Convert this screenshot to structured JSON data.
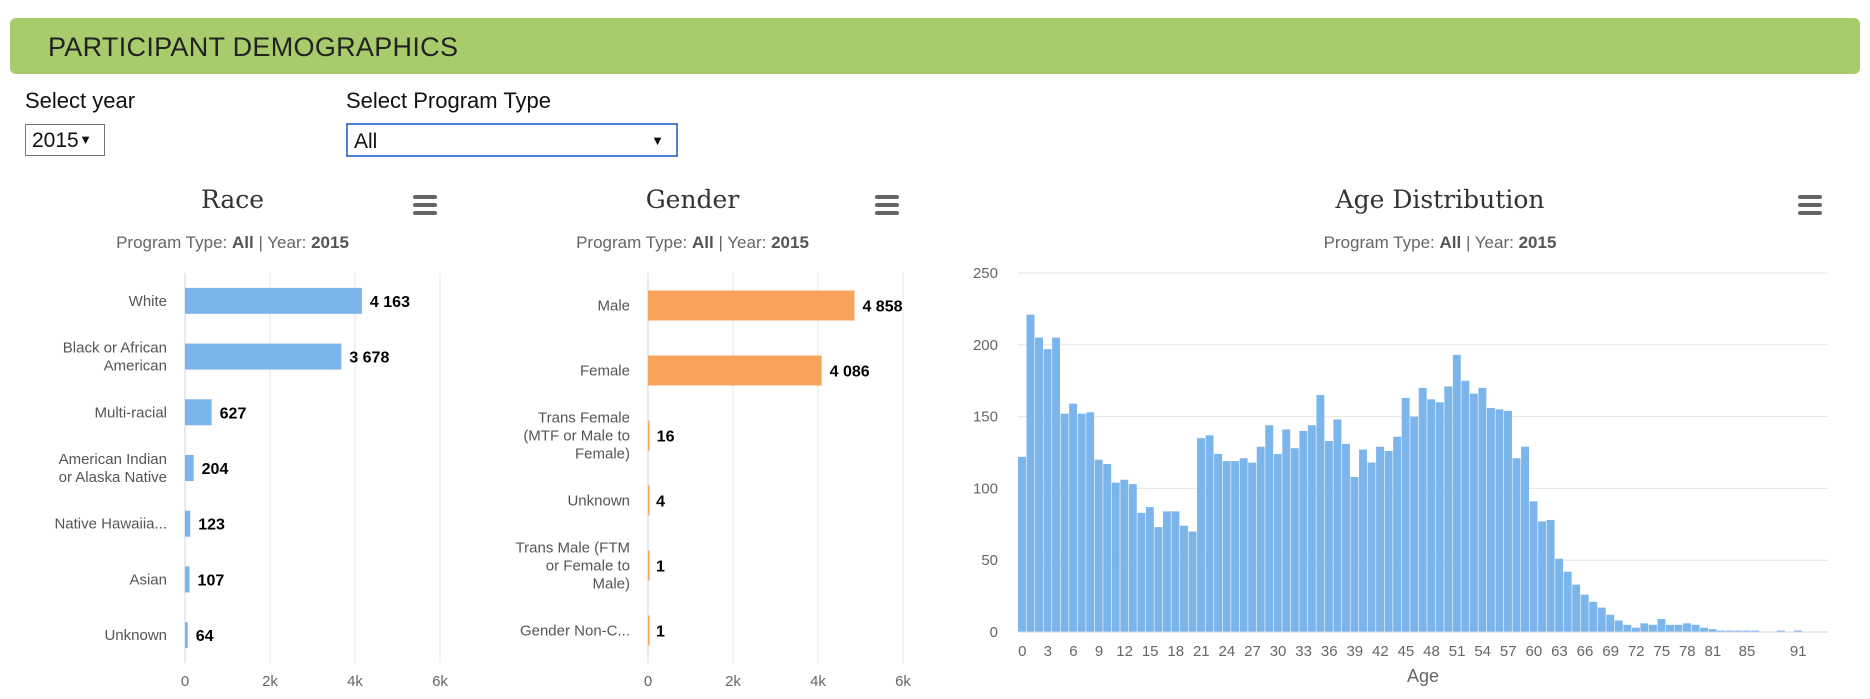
{
  "header": {
    "title": "PARTICIPANT DEMOGRAPHICS"
  },
  "controls": {
    "year_label": "Select year",
    "year_value": "2015",
    "program_label": "Select Program Type",
    "program_value": "All"
  },
  "colors": {
    "banner": "#a8cb6c",
    "blue": "#7cb5ec",
    "orange": "#f7a35c"
  },
  "subtitle": {
    "prefix": "Program Type: ",
    "program": "All",
    "sep": " | Year: ",
    "year": "2015"
  },
  "menu_icon": "hamburger-menu-icon",
  "chart_data": [
    {
      "type": "bar",
      "orientation": "horizontal",
      "title": "Race",
      "categories": [
        [
          "White"
        ],
        [
          "Black or African",
          "American"
        ],
        [
          "Multi-racial"
        ],
        [
          "American Indian",
          "or Alaska Native"
        ],
        [
          "Native Hawaiia..."
        ],
        [
          "Asian"
        ],
        [
          "Unknown"
        ]
      ],
      "values": [
        4163,
        3678,
        627,
        204,
        123,
        107,
        64
      ],
      "data_labels": [
        "4 163",
        "3 678",
        "627",
        "204",
        "123",
        "107",
        "64"
      ],
      "xlim": [
        0,
        6000
      ],
      "ticks": [
        0,
        2000,
        4000,
        6000
      ],
      "tick_labels": [
        "0",
        "2k",
        "4k",
        "6k"
      ],
      "color": "#7cb5ec"
    },
    {
      "type": "bar",
      "orientation": "horizontal",
      "title": "Gender",
      "categories": [
        [
          "Male"
        ],
        [
          "Female"
        ],
        [
          "Trans Female",
          "(MTF or Male to",
          "Female)"
        ],
        [
          "Unknown"
        ],
        [
          "Trans Male (FTM",
          "or Female to",
          "Male)"
        ],
        [
          "Gender Non-C..."
        ]
      ],
      "values": [
        4858,
        4086,
        16,
        4,
        1,
        1
      ],
      "data_labels": [
        "4 858",
        "4 086",
        "16",
        "4",
        "1",
        "1"
      ],
      "xlim": [
        0,
        6000
      ],
      "ticks": [
        0,
        2000,
        4000,
        6000
      ],
      "tick_labels": [
        "0",
        "2k",
        "4k",
        "6k"
      ],
      "color": "#f7a35c"
    },
    {
      "type": "bar",
      "title": "Age Distribution",
      "xlabel": "Age",
      "x": [
        0,
        1,
        2,
        3,
        4,
        5,
        6,
        7,
        8,
        9,
        10,
        11,
        12,
        13,
        14,
        15,
        16,
        17,
        18,
        19,
        20,
        21,
        22,
        23,
        24,
        25,
        26,
        27,
        28,
        29,
        30,
        31,
        32,
        33,
        34,
        35,
        36,
        37,
        38,
        39,
        40,
        41,
        42,
        43,
        44,
        45,
        46,
        47,
        48,
        49,
        50,
        51,
        52,
        53,
        54,
        55,
        56,
        57,
        58,
        59,
        60,
        61,
        62,
        63,
        64,
        65,
        66,
        67,
        68,
        69,
        70,
        71,
        72,
        73,
        74,
        75,
        76,
        77,
        78,
        79,
        80,
        81,
        82,
        83,
        84,
        85,
        86,
        87,
        88,
        89,
        90,
        91,
        92,
        93,
        94
      ],
      "values": [
        122,
        221,
        205,
        197,
        205,
        152,
        159,
        152,
        153,
        120,
        117,
        104,
        106,
        103,
        83,
        87,
        73,
        84,
        84,
        74,
        70,
        135,
        137,
        124,
        119,
        119,
        121,
        118,
        129,
        144,
        124,
        141,
        128,
        140,
        144,
        165,
        133,
        148,
        131,
        108,
        127,
        118,
        129,
        126,
        136,
        163,
        150,
        170,
        162,
        160,
        171,
        193,
        175,
        166,
        170,
        156,
        155,
        154,
        121,
        129,
        91,
        77,
        78,
        51,
        42,
        33,
        26,
        21,
        17,
        12,
        8,
        5,
        3,
        6,
        5,
        9,
        5,
        5,
        6,
        5,
        3,
        2,
        1,
        1,
        1,
        1,
        1,
        0,
        0,
        1,
        0,
        1,
        0,
        0,
        0
      ],
      "xtick_labels": [
        "0",
        "3",
        "6",
        "9",
        "12",
        "15",
        "18",
        "21",
        "24",
        "27",
        "30",
        "33",
        "36",
        "39",
        "42",
        "45",
        "48",
        "51",
        "54",
        "57",
        "60",
        "63",
        "66",
        "69",
        "72",
        "75",
        "78",
        "81",
        "85",
        "91"
      ],
      "xtick_values": [
        0,
        3,
        6,
        9,
        12,
        15,
        18,
        21,
        24,
        27,
        30,
        33,
        36,
        39,
        42,
        45,
        48,
        51,
        54,
        57,
        60,
        63,
        66,
        69,
        72,
        75,
        78,
        81,
        85,
        91
      ],
      "ylim": [
        0,
        250
      ],
      "yticks": [
        0,
        50,
        100,
        150,
        200,
        250
      ],
      "grid": true,
      "color": "#7cb5ec"
    }
  ]
}
